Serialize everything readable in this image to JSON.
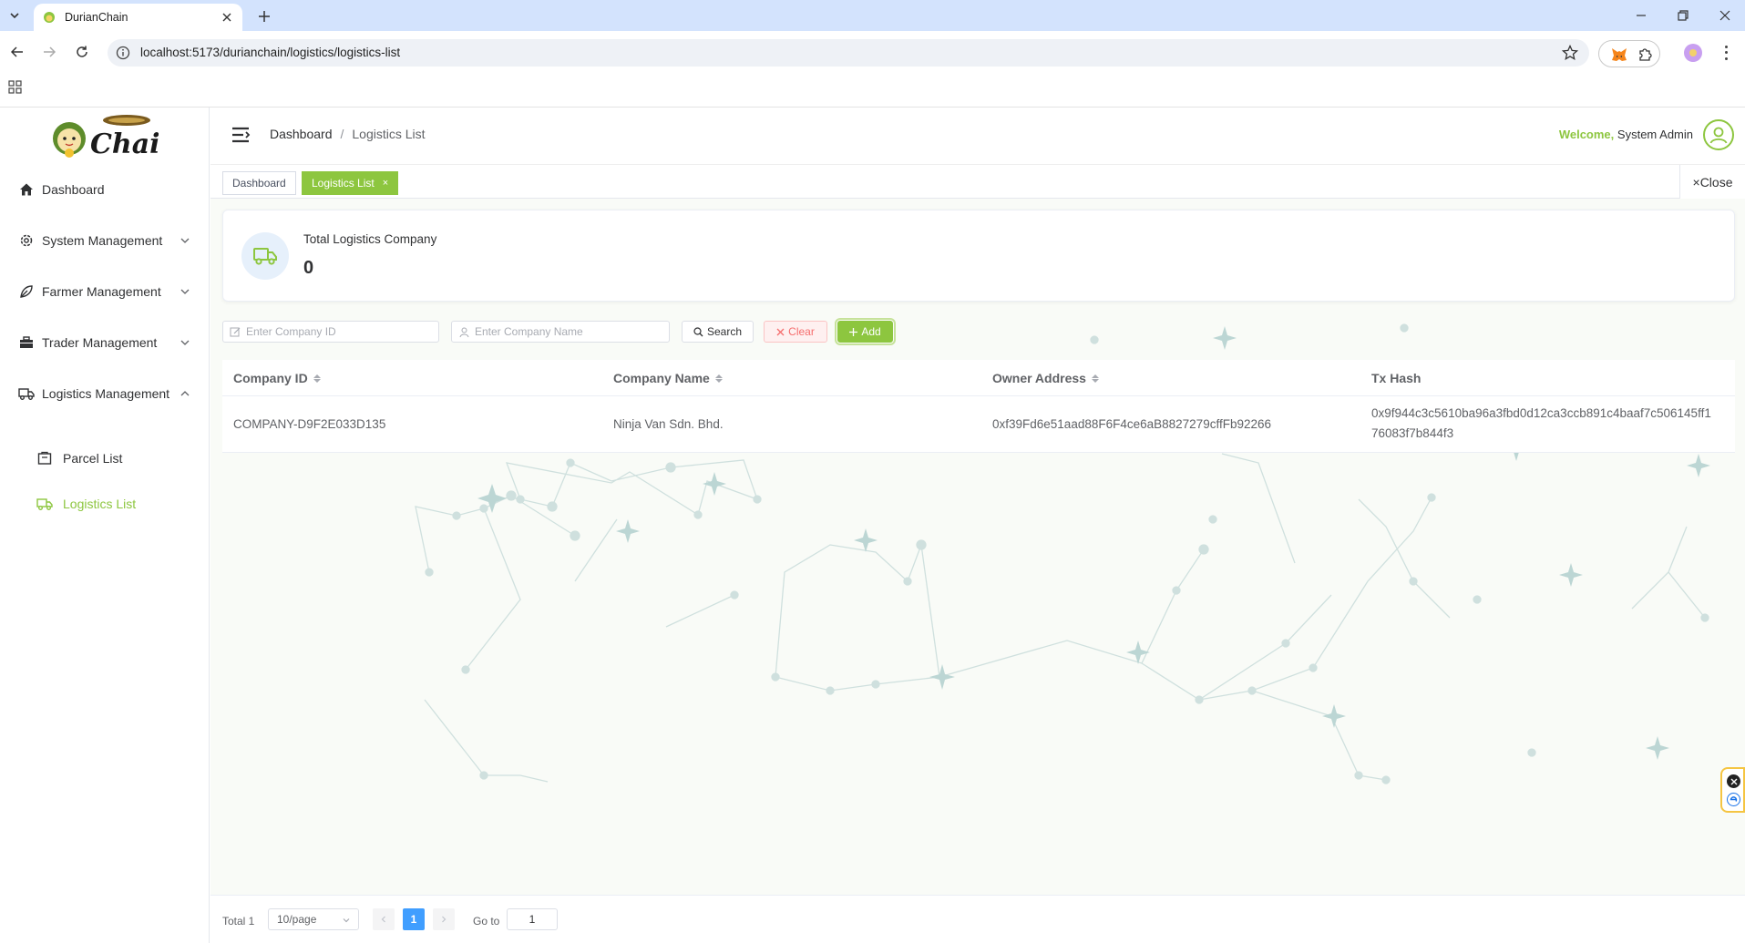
{
  "browser": {
    "tab_title": "DurianChain",
    "url": "localhost:5173/durianchain/logistics/logistics-list"
  },
  "sidebar": {
    "logo_text": "Chain",
    "items": [
      {
        "label": "Dashboard",
        "icon": "home-icon"
      },
      {
        "label": "System Management",
        "icon": "gear-icon"
      },
      {
        "label": "Farmer Management",
        "icon": "leaf-icon"
      },
      {
        "label": "Trader Management",
        "icon": "briefcase-icon"
      },
      {
        "label": "Logistics Management",
        "icon": "truck-icon"
      }
    ],
    "sub_items": [
      {
        "label": "Parcel List",
        "icon": "parcel-icon"
      },
      {
        "label": "Logistics List",
        "icon": "truck-icon",
        "active": true
      }
    ]
  },
  "header": {
    "breadcrumb_home": "Dashboard",
    "breadcrumb_sep": "/",
    "breadcrumb_current": "Logistics List",
    "welcome": "Welcome,",
    "user_name": "System Admin"
  },
  "tags": {
    "items": [
      "Dashboard",
      "Logistics List"
    ],
    "close_label": "Close",
    "close_x": "×"
  },
  "stat": {
    "label": "Total Logistics Company",
    "value": "0"
  },
  "filters": {
    "company_id_placeholder": "Enter Company ID",
    "company_name_placeholder": "Enter Company Name",
    "search_label": "Search",
    "clear_label": "Clear",
    "add_label": "Add"
  },
  "table": {
    "headers": [
      "Company ID",
      "Company Name",
      "Owner Address",
      "Tx Hash"
    ],
    "rows": [
      {
        "company_id": "COMPANY-D9F2E033D135",
        "company_name": "Ninja Van Sdn. Bhd.",
        "owner_address": "0xf39Fd6e51aad88F6F4ce6aB8827279cffFb92266",
        "tx_hash_line1": "0x9f944c3c5610ba96a3fbd0d12ca3ccb891c4baaf7c506145ff1",
        "tx_hash_line2": "76083f7b844f3"
      }
    ]
  },
  "pagination": {
    "total": "Total 1",
    "page_size": "10/page",
    "current_page": "1",
    "goto_label": "Go to",
    "goto_value": "1"
  },
  "colors": {
    "accent": "#8dc63f",
    "danger": "#f56c6c",
    "pager_active": "#409eff"
  }
}
